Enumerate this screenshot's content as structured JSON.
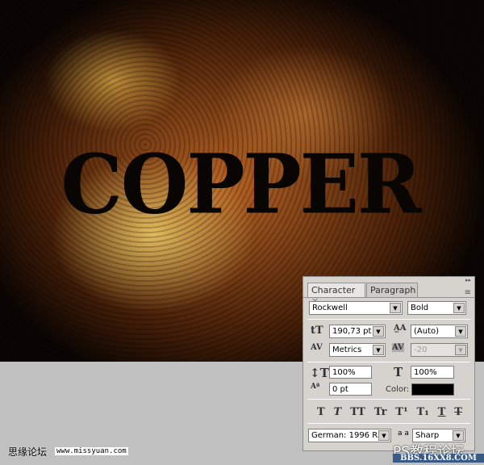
{
  "canvas": {
    "text": "COPPER"
  },
  "panel": {
    "tabs": [
      {
        "label": "Character",
        "close": "×"
      },
      {
        "label": "Paragraph"
      }
    ],
    "font_family": "Rockwell",
    "font_style": "Bold",
    "font_size": "190,73 pt",
    "leading": "(Auto)",
    "kerning": "Metrics",
    "tracking": "-20",
    "vertical_scale": "100%",
    "horizontal_scale": "100%",
    "baseline_shift": "0 pt",
    "color_label": "Color:",
    "color": "#000000",
    "style_buttons": [
      "T",
      "T",
      "TT",
      "Tr",
      "T¹",
      "T₁",
      "T",
      "T"
    ],
    "language": "German: 1996 R...",
    "antialias_label": "a a",
    "antialias": "Sharp"
  },
  "watermarks": {
    "site_cn": "思缘论坛",
    "site_url": "www.missyuan.com",
    "ps_cn": "PS教程论坛",
    "ps_url": "BBS.16XX8.COM"
  }
}
